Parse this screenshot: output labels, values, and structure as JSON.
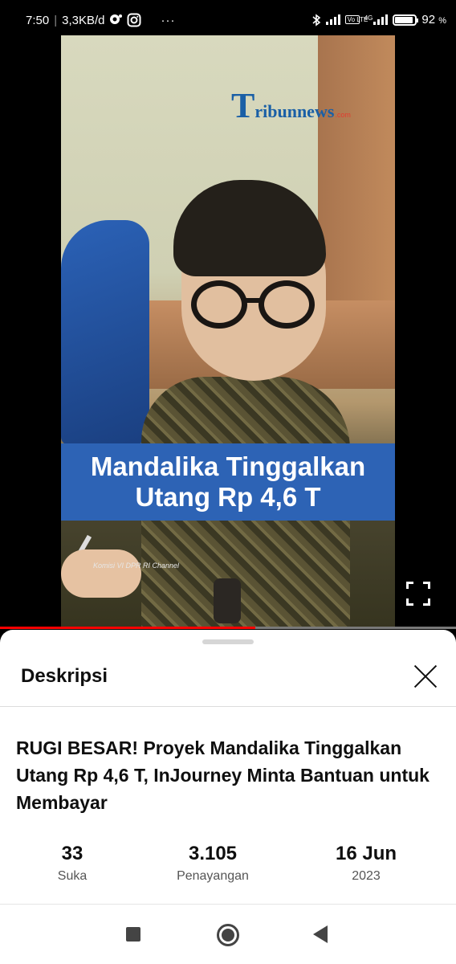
{
  "status_bar": {
    "time": "7:50",
    "net_speed": "3,3KB/d",
    "volte_label": "Vo LTE",
    "network_label": "4G",
    "battery_percent": "92",
    "percent_sign": "%",
    "more_label": "···"
  },
  "video": {
    "logo_first": "T",
    "logo_rest": "ribunnews",
    "logo_suffix": ".com",
    "caption_line1": "Mandalika Tinggalkan",
    "caption_line2": "Utang Rp 4,6 T",
    "channel_watermark": "Komisi VI DPR RI Channel",
    "progress_fraction": 0.56,
    "progress_color": "#ff0000",
    "caption_color": "#2d63b5"
  },
  "sheet": {
    "title": "Deskripsi",
    "video_title": "RUGI BESAR! Proyek Mandalika Tinggalkan Utang Rp 4,6 T, InJourney Minta Bantuan untuk Membayar",
    "stats": [
      {
        "value": "33",
        "label": "Suka"
      },
      {
        "value": "3.105",
        "label": "Penayangan"
      },
      {
        "value": "16 Jun",
        "label": "2023"
      }
    ]
  },
  "icons": {
    "close": "close-icon",
    "fullscreen": "fullscreen-icon",
    "recents": "recents-icon",
    "home": "home-icon",
    "back": "back-icon"
  }
}
